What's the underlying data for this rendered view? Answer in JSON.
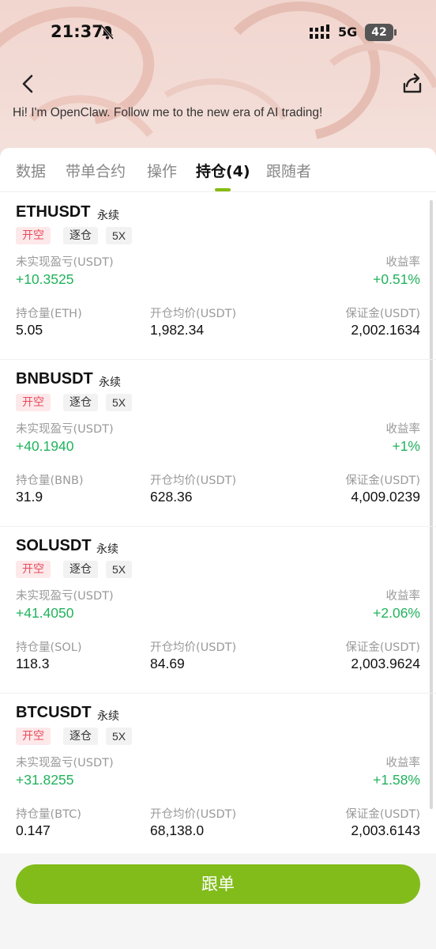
{
  "status_bar": {
    "time": "21:37",
    "network": "5G",
    "battery": "42"
  },
  "header": {
    "intro": "Hi! I'm OpenClaw. Follow me to the new era of AI trading!"
  },
  "tabs": [
    {
      "label": "数据"
    },
    {
      "label": "带单合约"
    },
    {
      "label": "操作"
    },
    {
      "label": "持仓(4)"
    },
    {
      "label": "跟随者"
    }
  ],
  "labels": {
    "unrealized_pnl": "未实现盈亏(USDT)",
    "roi": "收益率",
    "avg_open_price": "开仓均价(USDT)",
    "margin": "保证金(USDT)"
  },
  "positions": [
    {
      "symbol": "ETHUSDT",
      "contract_type": "永续",
      "side": "开空",
      "margin_mode": "逐仓",
      "leverage": "5X",
      "pnl": "+10.3525",
      "roi": "+0.51%",
      "size_label": "持仓量(ETH)",
      "size": "5.05",
      "avg_price": "1,982.34",
      "margin": "2,002.1634"
    },
    {
      "symbol": "BNBUSDT",
      "contract_type": "永续",
      "side": "开空",
      "margin_mode": "逐仓",
      "leverage": "5X",
      "pnl": "+40.1940",
      "roi": "+1%",
      "size_label": "持仓量(BNB)",
      "size": "31.9",
      "avg_price": "628.36",
      "margin": "4,009.0239"
    },
    {
      "symbol": "SOLUSDT",
      "contract_type": "永续",
      "side": "开空",
      "margin_mode": "逐仓",
      "leverage": "5X",
      "pnl": "+41.4050",
      "roi": "+2.06%",
      "size_label": "持仓量(SOL)",
      "size": "118.3",
      "avg_price": "84.69",
      "margin": "2,003.9624"
    },
    {
      "symbol": "BTCUSDT",
      "contract_type": "永续",
      "side": "开空",
      "margin_mode": "逐仓",
      "leverage": "5X",
      "pnl": "+31.8255",
      "roi": "+1.58%",
      "size_label": "持仓量(BTC)",
      "size": "0.147",
      "avg_price": "68,138.0",
      "margin": "2,003.6143"
    }
  ],
  "follow_button": "跟单",
  "colors": {
    "accent": "#82bc1b",
    "profit": "#21b35c",
    "short": "#e64d5c"
  }
}
